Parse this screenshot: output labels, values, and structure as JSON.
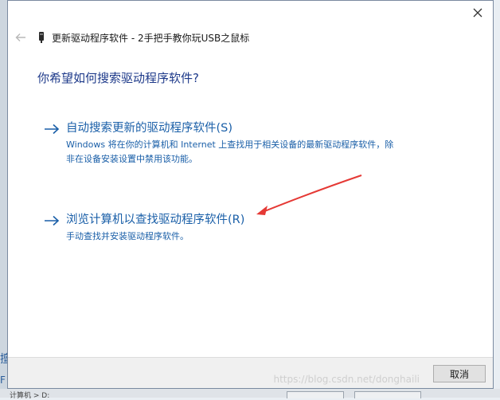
{
  "dialog": {
    "header_title": "更新驱动程序软件 - 2手把手教你玩USB之鼠标",
    "question": "你希望如何搜索驱动程序软件?",
    "options": [
      {
        "title": "自动搜索更新的驱动程序软件(S)",
        "description": "Windows 将在你的计算机和 Internet 上查找用于相关设备的最新驱动程序软件，除非在设备安装设置中禁用该功能。"
      },
      {
        "title": "浏览计算机以查找驱动程序软件(R)",
        "description": "手动查找并安装驱动程序软件。"
      }
    ],
    "cancel_label": "取消",
    "watermark": "https://blog.csdn.net/donghaili"
  },
  "background": {
    "left_glyph_1": "擅",
    "left_glyph_2": "F",
    "bottom_text": "计算机 > D:"
  },
  "colors": {
    "link": "#1a5fa8",
    "question": "#1e3a8a",
    "annotation_arrow": "#e53935"
  },
  "icons": {
    "back": "back-arrow-icon",
    "device": "usb-device-icon",
    "close": "close-icon",
    "option_arrow": "right-arrow-icon"
  }
}
